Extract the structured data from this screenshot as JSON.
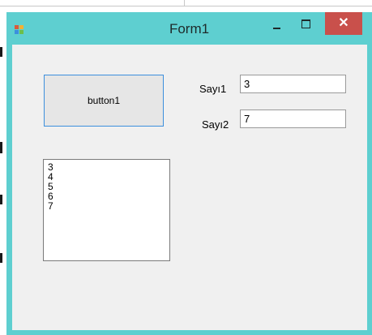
{
  "window": {
    "title": "Form1",
    "close_glyph": "✕",
    "title_bar_color": "#5ecfd0",
    "close_color": "#c9504b",
    "client_color": "#f0f0f0"
  },
  "form": {
    "button_label": "button1",
    "sayi1": {
      "label": "Sayı1",
      "value": "3"
    },
    "sayi2": {
      "label": "Sayı2",
      "value": "7"
    },
    "listbox_items": [
      "3",
      "4",
      "5",
      "6",
      "7"
    ]
  },
  "icons": {
    "app": "app-icon",
    "minimize": "minimize-icon",
    "maximize": "maximize-icon",
    "close": "close-icon"
  },
  "accent_color": "#3c8fdd"
}
